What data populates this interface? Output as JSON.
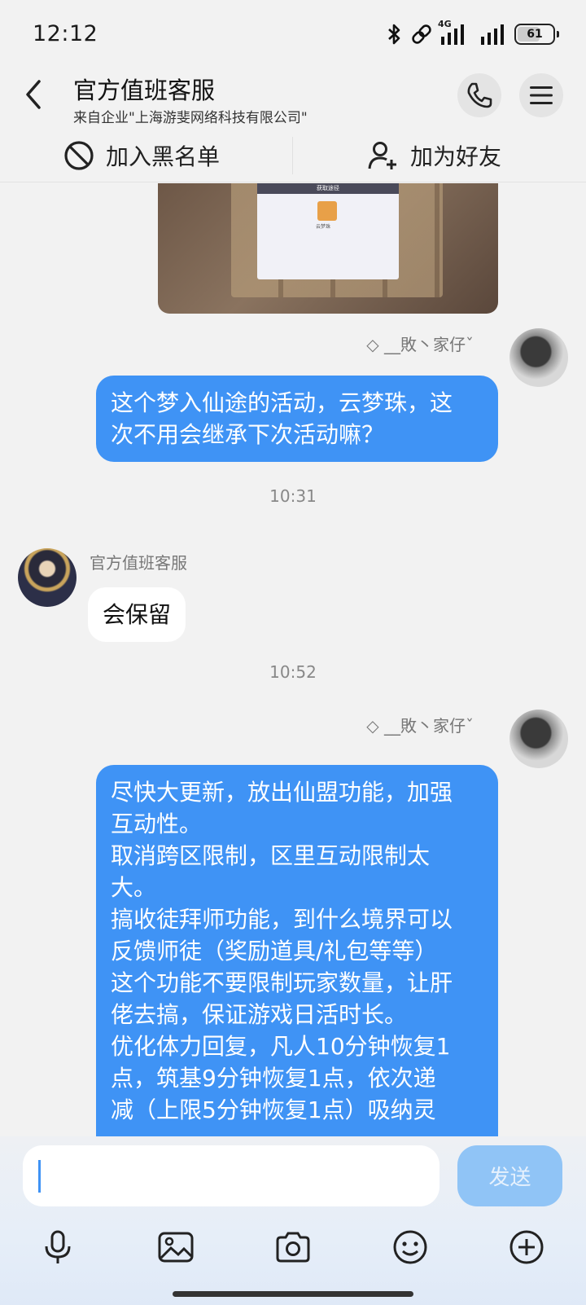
{
  "status_bar": {
    "time": "12:12",
    "network": "4G",
    "battery": "61",
    "icons": [
      "bluetooth-icon",
      "link-icon",
      "signal-icon",
      "signal-icon",
      "battery-icon"
    ]
  },
  "header": {
    "title": "官方值班客服",
    "subtitle": "来自企业\"上海游斐网络科技有限公司\"",
    "icons": [
      "back-arrow-icon",
      "phone-icon",
      "menu-icon"
    ]
  },
  "actions": {
    "blacklist_label": "加入黑名单",
    "add_friend_label": "加为好友"
  },
  "image_message": {
    "popup_title": "获取途径",
    "item_caption": "云梦珠"
  },
  "messages": [
    {
      "sender": "◇ __敗丶家仔ˇ",
      "side": "right",
      "text_lines": [
        "这个梦入仙途的活动，云梦珠，这",
        "次不用会继承下次活动嘛？"
      ]
    },
    {
      "timestamp": "10:31"
    },
    {
      "sender": "官方值班客服",
      "side": "left",
      "text_lines": [
        "会保留"
      ]
    },
    {
      "timestamp": "10:52"
    },
    {
      "sender": "◇ __敗丶家仔ˇ",
      "side": "right",
      "text_lines": [
        "尽快大更新，放出仙盟功能，加强",
        "互动性。",
        "取消跨区限制，区里互动限制太",
        "大。",
        "搞收徒拜师功能，到什么境界可以",
        "反馈师徒（奖励道具/礼包等等）",
        "这个功能不要限制玩家数量，让肝",
        "佬去搞，保证游戏日活时长。",
        "优化体力回复，凡人10分钟恢复1",
        "点，筑基9分钟恢复1点，依次递",
        "减（上限5分钟恢复1点）吸纳灵"
      ]
    }
  ],
  "input": {
    "value": "",
    "send_label": "发送"
  },
  "toolbar": [
    "mic-icon",
    "image-icon",
    "camera-icon",
    "emoji-icon",
    "plus-icon"
  ],
  "colors": {
    "accent": "#3f93f5",
    "send_disabled": "#90c4f6",
    "background": "#f2f2f2"
  }
}
